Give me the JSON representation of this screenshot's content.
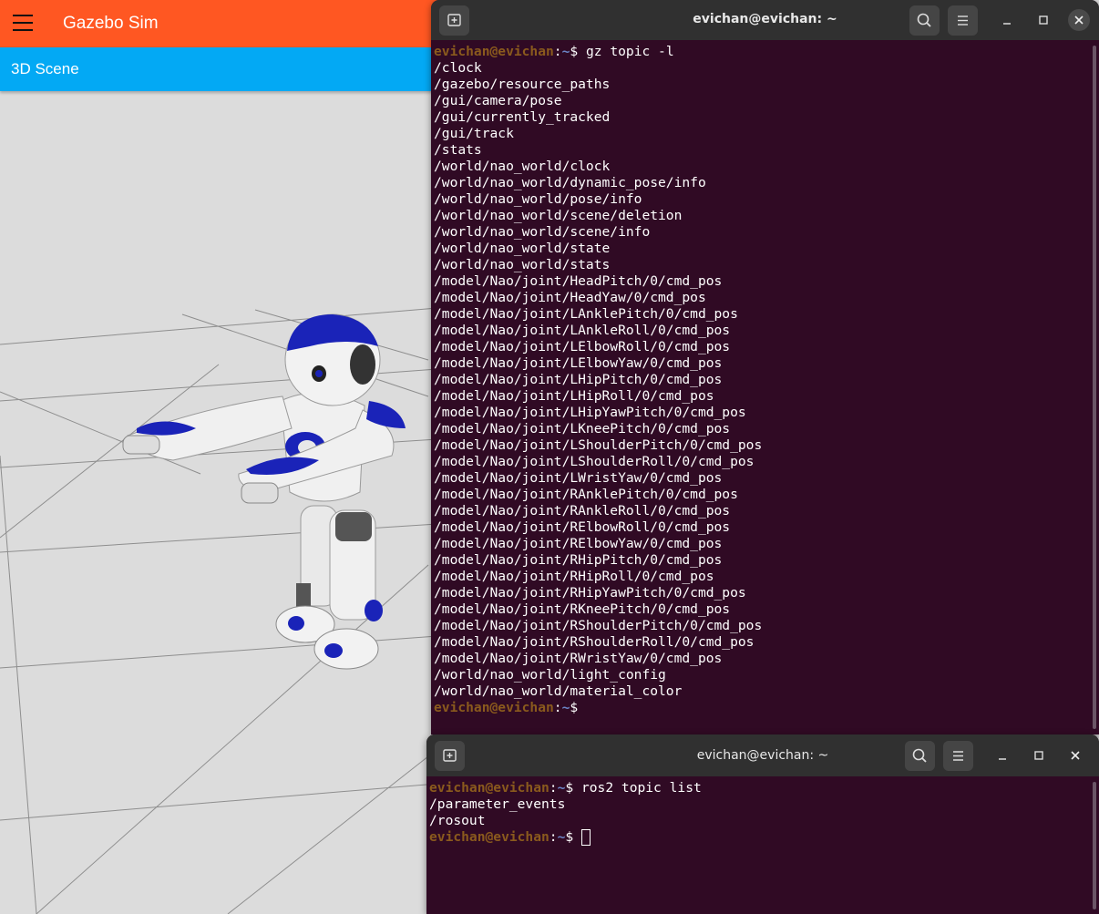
{
  "gazebo": {
    "title": "Gazebo Sim",
    "tab_label": "3D Scene",
    "colors": {
      "header": "#ff5722",
      "tabbar": "#03a9f4",
      "robot_accent": "#1a23b8"
    }
  },
  "terminal1": {
    "title": "evichan@evichan: ~",
    "prompt": {
      "user": "evichan@evichan",
      "sep": ":",
      "path": "~",
      "symbol": "$"
    },
    "command": " gz topic -l",
    "output": [
      "/clock",
      "/gazebo/resource_paths",
      "/gui/camera/pose",
      "/gui/currently_tracked",
      "/gui/track",
      "/stats",
      "/world/nao_world/clock",
      "/world/nao_world/dynamic_pose/info",
      "/world/nao_world/pose/info",
      "/world/nao_world/scene/deletion",
      "/world/nao_world/scene/info",
      "/world/nao_world/state",
      "/world/nao_world/stats",
      "/model/Nao/joint/HeadPitch/0/cmd_pos",
      "/model/Nao/joint/HeadYaw/0/cmd_pos",
      "/model/Nao/joint/LAnklePitch/0/cmd_pos",
      "/model/Nao/joint/LAnkleRoll/0/cmd_pos",
      "/model/Nao/joint/LElbowRoll/0/cmd_pos",
      "/model/Nao/joint/LElbowYaw/0/cmd_pos",
      "/model/Nao/joint/LHipPitch/0/cmd_pos",
      "/model/Nao/joint/LHipRoll/0/cmd_pos",
      "/model/Nao/joint/LHipYawPitch/0/cmd_pos",
      "/model/Nao/joint/LKneePitch/0/cmd_pos",
      "/model/Nao/joint/LShoulderPitch/0/cmd_pos",
      "/model/Nao/joint/LShoulderRoll/0/cmd_pos",
      "/model/Nao/joint/LWristYaw/0/cmd_pos",
      "/model/Nao/joint/RAnklePitch/0/cmd_pos",
      "/model/Nao/joint/RAnkleRoll/0/cmd_pos",
      "/model/Nao/joint/RElbowRoll/0/cmd_pos",
      "/model/Nao/joint/RElbowYaw/0/cmd_pos",
      "/model/Nao/joint/RHipPitch/0/cmd_pos",
      "/model/Nao/joint/RHipRoll/0/cmd_pos",
      "/model/Nao/joint/RHipYawPitch/0/cmd_pos",
      "/model/Nao/joint/RKneePitch/0/cmd_pos",
      "/model/Nao/joint/RShoulderPitch/0/cmd_pos",
      "/model/Nao/joint/RShoulderRoll/0/cmd_pos",
      "/model/Nao/joint/RWristYaw/0/cmd_pos",
      "/world/nao_world/light_config",
      "/world/nao_world/material_color"
    ]
  },
  "terminal2": {
    "title": "evichan@evichan: ~",
    "prompt": {
      "user": "evichan@evichan",
      "sep": ":",
      "path": "~",
      "symbol": "$"
    },
    "command": " ros2 topic list",
    "output": [
      "/parameter_events",
      "/rosout"
    ]
  },
  "icons": {
    "new_tab": "new-tab-icon",
    "search": "search-icon",
    "menu": "hamburger-icon",
    "minimize": "minimize-icon",
    "maximize": "maximize-icon",
    "close": "close-icon"
  }
}
